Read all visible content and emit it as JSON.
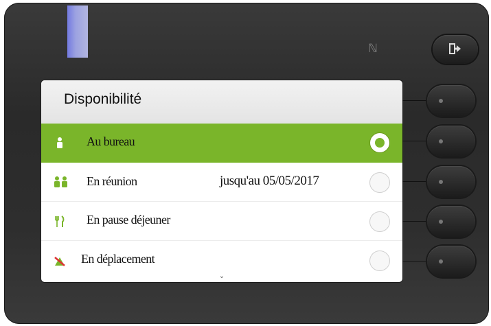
{
  "screen": {
    "title": "Disponibilité"
  },
  "status_list": [
    {
      "label": "Au bureau",
      "until": "",
      "selected": true,
      "icon": "person-icon"
    },
    {
      "label": "En réunion",
      "until": "jusqu'au 05/05/2017",
      "selected": false,
      "icon": "meeting-people-icon"
    },
    {
      "label": "En pause déjeuner",
      "until": "",
      "selected": false,
      "icon": "fork-knife-icon"
    },
    {
      "label": "En déplacement",
      "until": "",
      "selected": false,
      "icon": "travel-icon"
    }
  ],
  "colors": {
    "accent": "#7ab52a",
    "led": "#aeb5ff",
    "phone_body": "#2e2e2e"
  },
  "icons": {
    "scroll_indicator": "chevron-down-icon",
    "exit": "exit-arrow-icon",
    "nfc": "nfc-icon"
  }
}
